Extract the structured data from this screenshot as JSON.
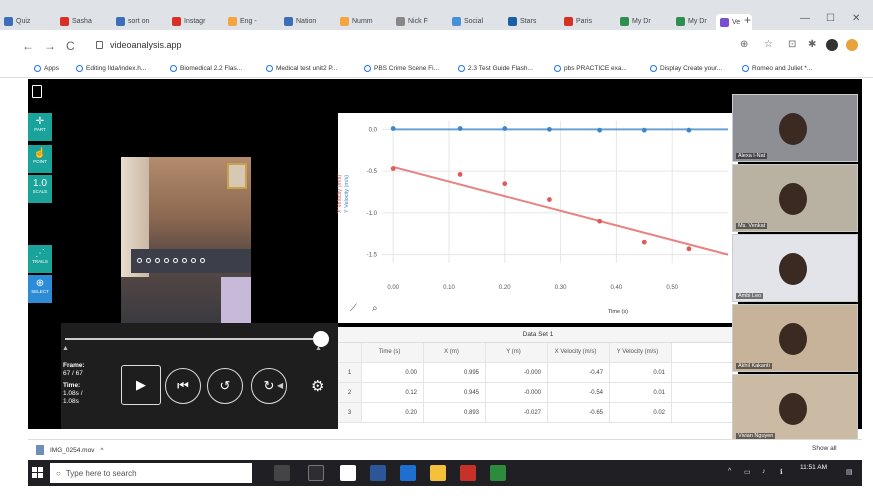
{
  "browser": {
    "tabs": [
      {
        "label": "Quiz",
        "color": "#3d6fb8"
      },
      {
        "label": "Sasha",
        "color": "#d93025"
      },
      {
        "label": "sort on",
        "color": "#3d6fb8"
      },
      {
        "label": "Instagr",
        "color": "#d93025"
      },
      {
        "label": "Eng -",
        "color": "#f4a53b"
      },
      {
        "label": "Nation",
        "color": "#3d6fb8"
      },
      {
        "label": "Numm",
        "color": "#f4a53b"
      },
      {
        "label": "Nick F",
        "color": "#888888"
      },
      {
        "label": "Social",
        "color": "#4a90d9"
      },
      {
        "label": "Stars",
        "color": "#1b5fa8"
      },
      {
        "label": "Paris",
        "color": "#d93025"
      },
      {
        "label": "My Dr",
        "color": "#2f8f4e"
      },
      {
        "label": "My Dr",
        "color": "#2f8f4e"
      },
      {
        "label": "Ve",
        "color": "#7a4fd0"
      }
    ],
    "url": "videoanalysis.app",
    "bookmarks": [
      "Apps",
      "Editing Ilda/index.h...",
      "Biomedical 2.2 Flas...",
      "Medical test unit2 P...",
      "PBS Crime Scene Fi...",
      "2.3 Test Guide Flash...",
      "pbs PRACTICE exa...",
      "Display Create your...",
      "Romeo and Juliet *..."
    ]
  },
  "app": {
    "tools": [
      {
        "label": "PART",
        "icon": "✛"
      },
      {
        "label": "POINT",
        "icon": "☝"
      },
      {
        "label": "SCALE",
        "icon": "1.0"
      },
      {
        "label": "TRAILS",
        "icon": "⋰"
      },
      {
        "label": "SELECT",
        "icon": "⊕"
      }
    ],
    "frame_label": "Frame:",
    "frame_value": "67 / 67",
    "time_label": "Time:",
    "time_value": "1.08s /",
    "time_total": "1.08s",
    "graph": {
      "x_axis_label": "Time (s)",
      "y_axis_label_x": "X Velocity (m/s)",
      "y_axis_label_y": "Y Velocity (m/s)"
    },
    "table": {
      "title": "Data Set 1",
      "headers": [
        "",
        "Time (s)",
        "X (m)",
        "Y (m)",
        "X Velocity (m/s)",
        "Y Velocity (m/s)"
      ],
      "rows": [
        [
          "1",
          "0.00",
          "0.995",
          "-0.000",
          "-0.47",
          "0.01"
        ],
        [
          "2",
          "0.12",
          "0.945",
          "-0.000",
          "-0.54",
          "0.01"
        ],
        [
          "3",
          "0.20",
          "0.893",
          "-0.027",
          "-0.65",
          "0.02"
        ]
      ]
    }
  },
  "chart_data": {
    "type": "scatter",
    "xlabel": "Time (s)",
    "ylabel": "X Velocity (m/s) / Y Velocity (m/s)",
    "xlim": [
      -0.02,
      0.6
    ],
    "ylim": [
      -1.6,
      0.1
    ],
    "x_ticks": [
      "0.00",
      "0.10",
      "0.20",
      "0.30",
      "0.40",
      "0.50"
    ],
    "y_ticks": [
      "0.0",
      "-0.5",
      "-1.0",
      "-1.5"
    ],
    "series": [
      {
        "color": "#3d87c7",
        "x": [
          0.0,
          0.12,
          0.2,
          0.28,
          0.37,
          0.45,
          0.53
        ],
        "y": [
          0.01,
          0.01,
          0.01,
          0.0,
          -0.01,
          -0.01,
          -0.01
        ],
        "fit": {
          "x": [
            0.0,
            0.6
          ],
          "y": [
            0.0,
            0.0
          ]
        }
      },
      {
        "color": "#e05a5a",
        "x": [
          0.0,
          0.12,
          0.2,
          0.28,
          0.37,
          0.45,
          0.53
        ],
        "y": [
          -0.47,
          -0.54,
          -0.65,
          -0.84,
          -1.1,
          -1.35,
          -1.43
        ],
        "fit": {
          "x": [
            0.0,
            0.6
          ],
          "y": [
            -0.45,
            -1.5
          ]
        }
      }
    ]
  },
  "participants": [
    {
      "name": "Alexa I-Nat",
      "bg": "#8e8f95"
    },
    {
      "name": "Ms. Venkat",
      "bg": "#b9b2a2"
    },
    {
      "name": "Ambi Leo",
      "bg": "#e2e4e9"
    },
    {
      "name": "Akhil Kakanti",
      "bg": "#c7b39a"
    },
    {
      "name": "Vivian Nguyen",
      "bg": "#cbbba5"
    }
  ],
  "downloads": {
    "file": "IMG_0254.mov",
    "show_all": "Show all"
  },
  "taskbar": {
    "search_placeholder": "Type here to search",
    "time": "11:51 AM"
  }
}
